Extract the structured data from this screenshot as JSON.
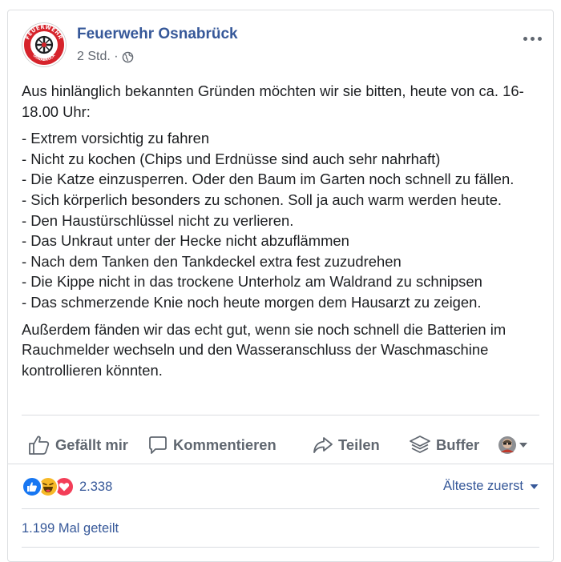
{
  "post": {
    "page_name": "Feuerwehr Osnabrück",
    "timestamp": "2 Std. ·",
    "privacy_icon": "globe-icon",
    "avatar_text_top": "FEUERWEHR",
    "avatar_text_bottom": "OSNABRÜCK",
    "intro": "Aus hinlänglich bekannten Gründen möchten wir sie bitten, heute von ca. 16-18.00 Uhr:",
    "list_items": [
      "- Extrem vorsichtig zu fahren",
      "- Nicht zu kochen (Chips und Erdnüsse sind auch sehr nahrhaft)",
      "- Die Katze einzusperren. Oder den Baum im Garten noch schnell zu fällen.",
      "- Sich körperlich besonders zu schonen. Soll ja auch warm werden heute.",
      "- Den Haustürschlüssel nicht zu verlieren.",
      "- Das Unkraut unter der Hecke nicht abzuflämmen",
      "- Nach dem Tanken den Tankdeckel extra fest zuzudrehen",
      "- Die Kippe nicht in das trockene Unterholz am Waldrand zu schnipsen",
      "- Das schmerzende Knie noch heute morgen dem Hausarzt zu zeigen."
    ],
    "outro": "Außerdem fänden wir das echt gut, wenn sie noch schnell die Batterien im Rauchmelder wechseln und den Wasseranschluss der Waschmaschine kontrollieren könnten."
  },
  "actions": {
    "like": "Gefällt mir",
    "comment": "Kommentieren",
    "share": "Teilen",
    "buffer": "Buffer"
  },
  "footer": {
    "reaction_count": "2.338",
    "sort_label": "Älteste zuerst",
    "shares": "1.199 Mal geteilt"
  },
  "colors": {
    "link_blue": "#365899",
    "like_blue": "#1877f2",
    "haha_yellow": "#f7b928",
    "love_red": "#f33e58",
    "fire_red": "#d6232b"
  }
}
